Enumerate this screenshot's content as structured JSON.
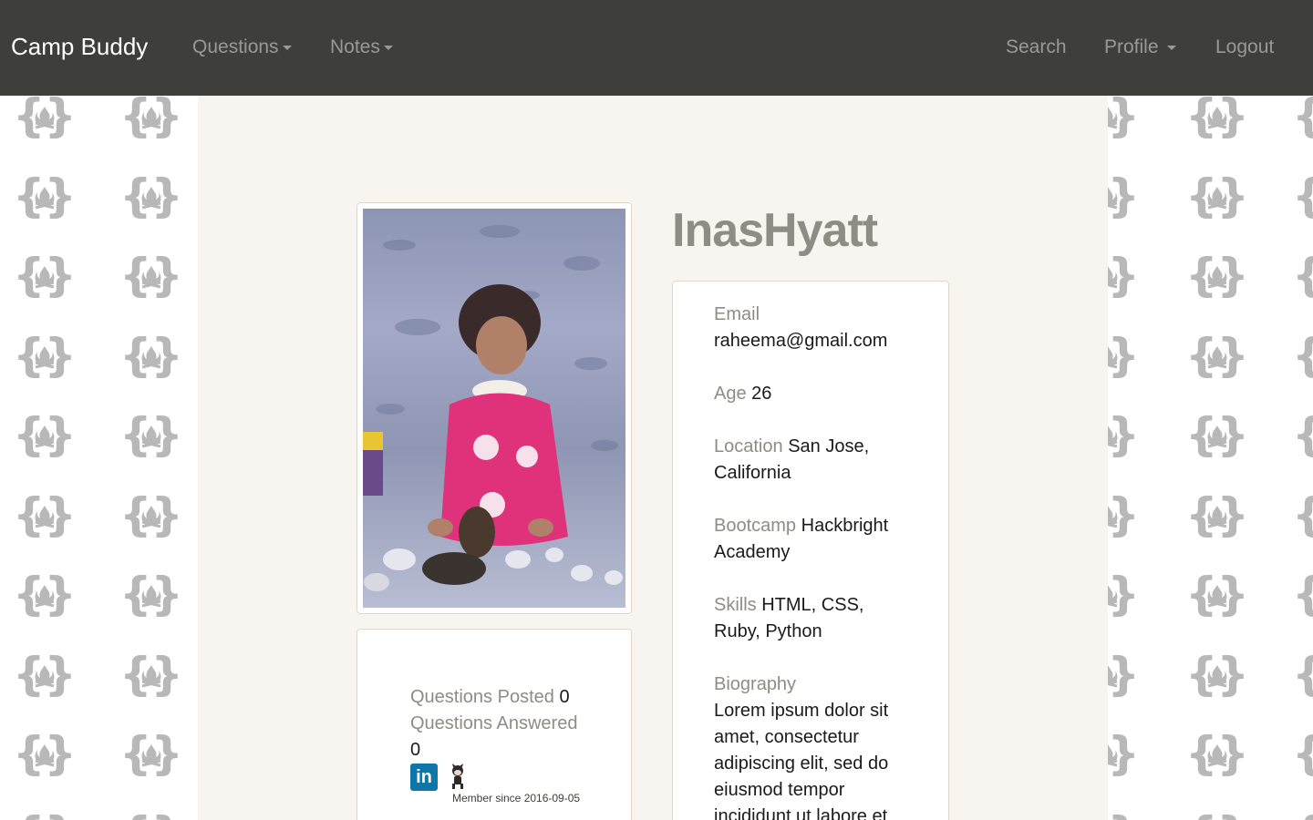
{
  "navbar": {
    "brand": "Camp Buddy",
    "questions": "Questions",
    "notes": "Notes",
    "search": "Search",
    "profile": "Profile",
    "logout": "Logout"
  },
  "profile": {
    "username": "InasHyatt",
    "email_label": "Email",
    "email": "raheema@gmail.com",
    "age_label": "Age",
    "age": "26",
    "location_label": "Location",
    "location": "San Jose, California",
    "bootcamp_label": "Bootcamp",
    "bootcamp": "Hackbright Academy",
    "skills_label": "Skills",
    "skills": "HTML, CSS, Ruby, Python",
    "bio_label": "Biography",
    "bio": "Lorem ipsum dolor sit amet, consectetur adipiscing elit, sed do eiusmod tempor incididunt ut labore et"
  },
  "stats": {
    "posted_label": "Questions Posted",
    "posted": "0",
    "answered_label": "Questions Answered",
    "answered": "0",
    "member_since": "Member since 2016-09-05"
  },
  "social": {
    "linkedin_icon": "linkedin-icon",
    "github_icon": "github-octocat-icon",
    "linkedin_text": "in"
  },
  "colors": {
    "navbar": "#3e3f3a",
    "page_bg": "#f8f5f0",
    "label": "#8e8c84",
    "linkedin": "#0e76a8"
  }
}
